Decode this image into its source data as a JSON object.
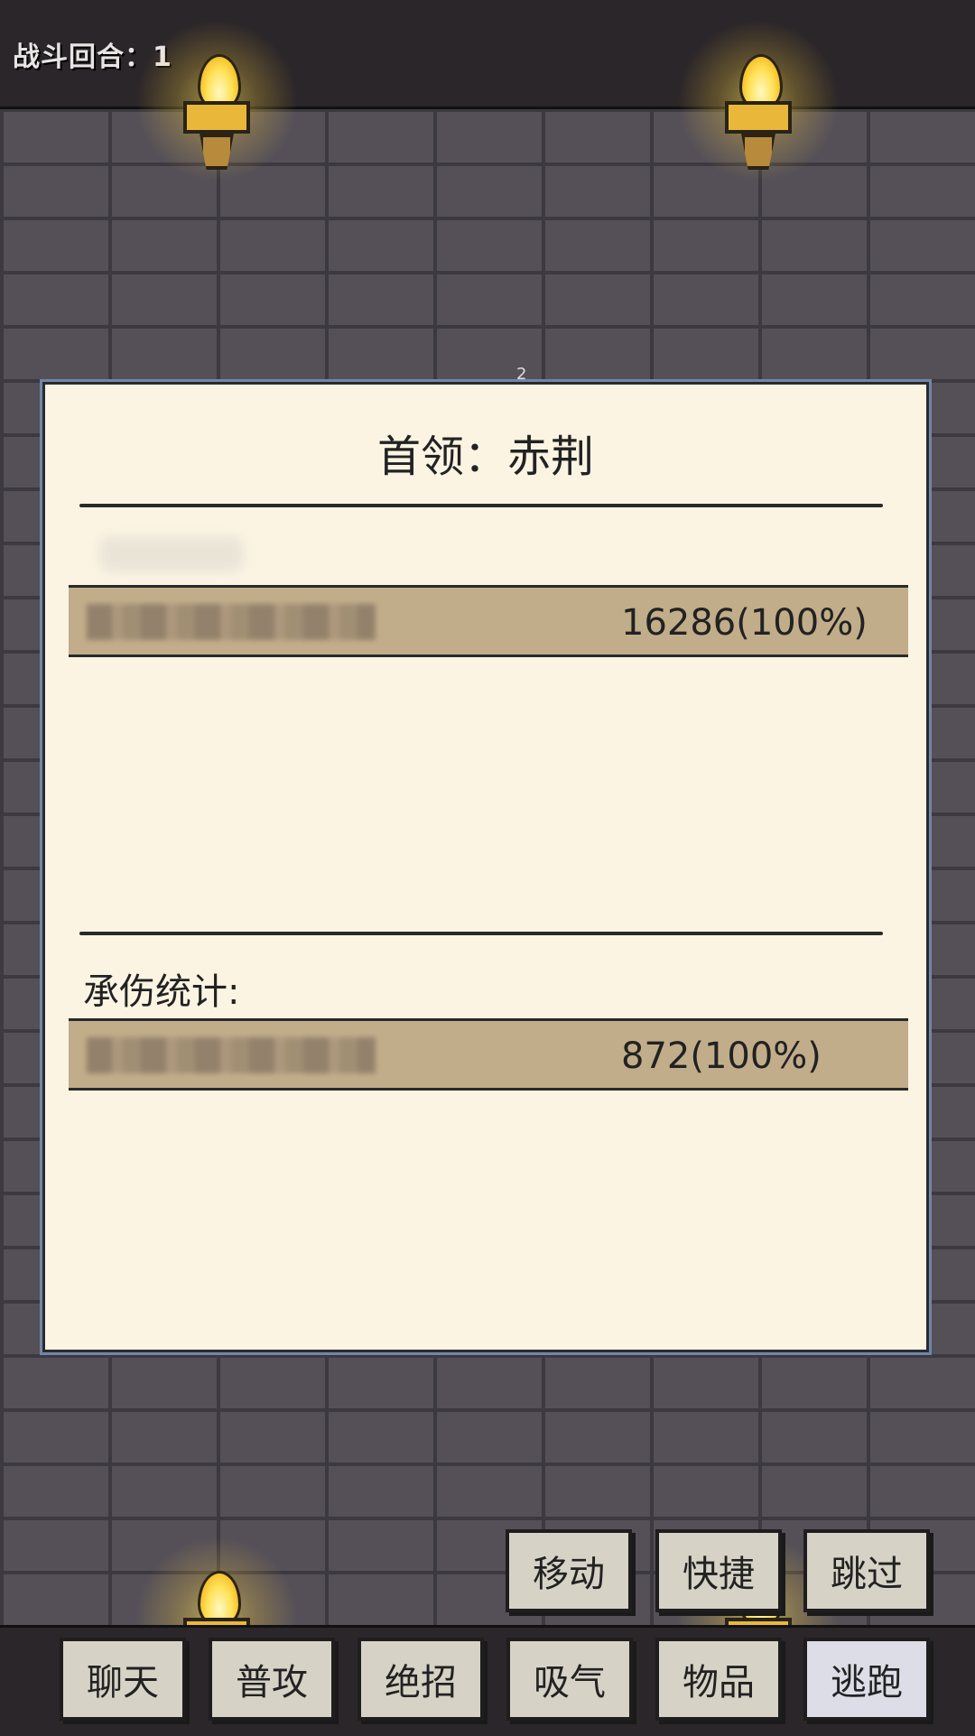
{
  "header": {
    "round_label": "战斗回合：1"
  },
  "page_indicator": "2",
  "panel": {
    "title": "首领：赤荆",
    "damage_row": {
      "value": "16286(100%)"
    },
    "tank_section_label": "承伤统计:",
    "tank_row": {
      "value": "872(100%)"
    }
  },
  "actions_top": [
    {
      "label": "移动"
    },
    {
      "label": "快捷"
    },
    {
      "label": "跳过"
    }
  ],
  "actions_bottom": [
    {
      "label": "聊天"
    },
    {
      "label": "普攻"
    },
    {
      "label": "绝招"
    },
    {
      "label": "吸气"
    },
    {
      "label": "物品"
    },
    {
      "label": "逃跑"
    }
  ],
  "colors": {
    "panel_bg": "#fbf4e3",
    "bar_fill": "#c2ad8a",
    "wall": "#555058",
    "torch_flame": "#ffe25a"
  }
}
